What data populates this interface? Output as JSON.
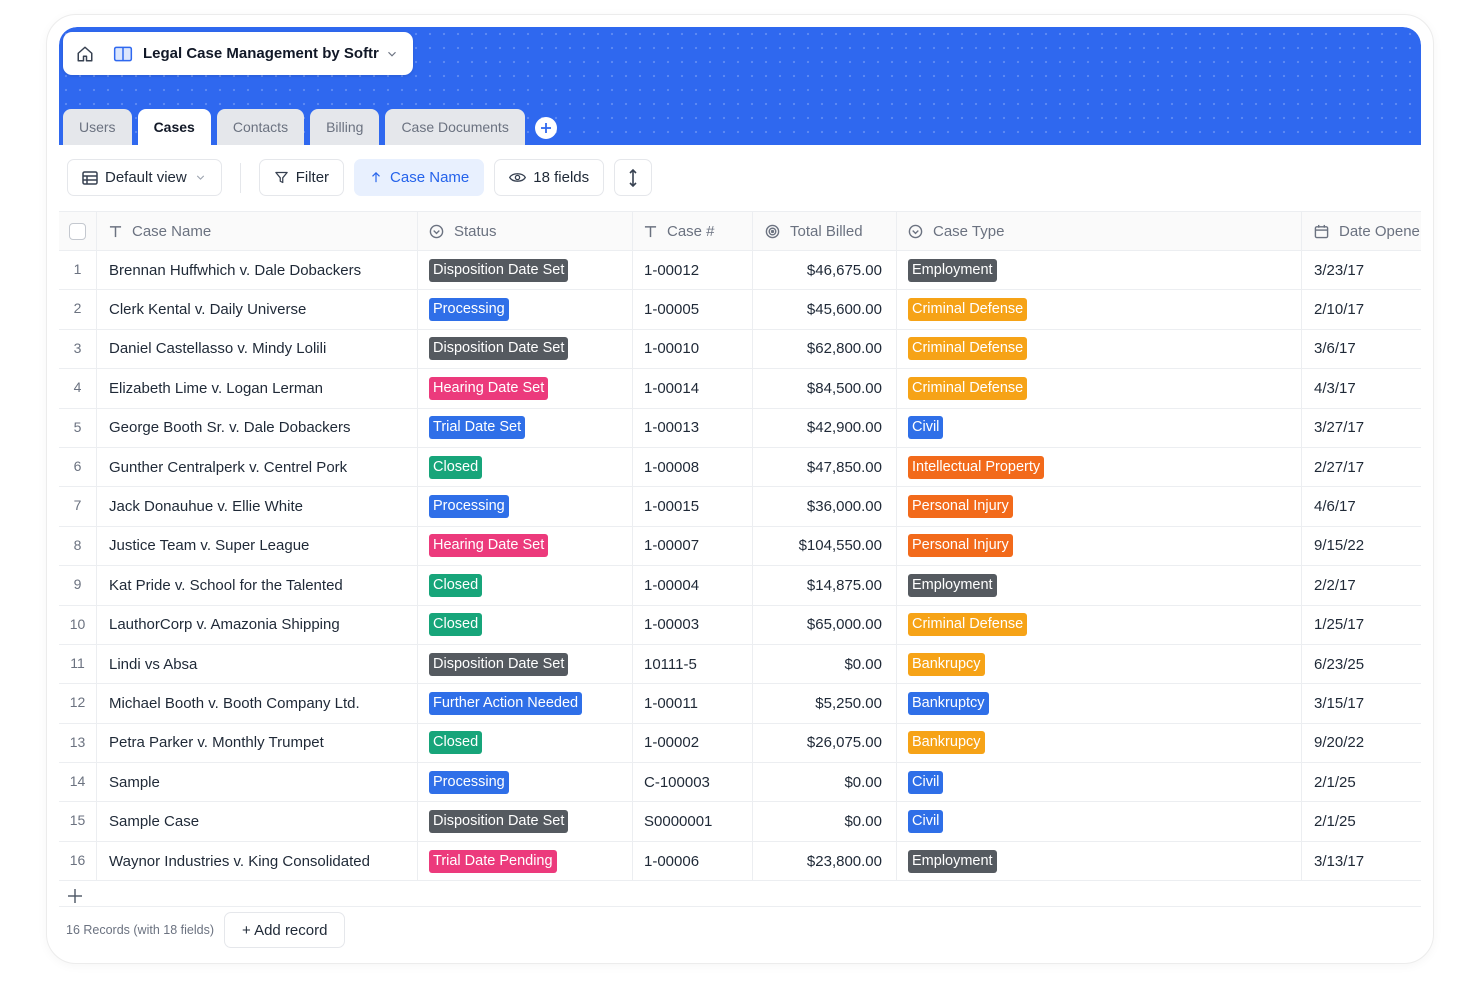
{
  "app": {
    "title": "Legal Case Management by Softr"
  },
  "tabs": [
    "Users",
    "Cases",
    "Contacts",
    "Billing",
    "Case Documents"
  ],
  "active_tab": "Cases",
  "toolbar": {
    "view_label": "Default view",
    "filter_label": "Filter",
    "sort_label": "Case Name",
    "fields_label": "18 fields"
  },
  "columns": {
    "case_name": "Case Name",
    "status": "Status",
    "case_number": "Case #",
    "total_billed": "Total Billed",
    "case_type": "Case Type",
    "date_opened": "Date Opene"
  },
  "colors": {
    "banner": "#2f68ef",
    "Disposition Date Set": "#555a60",
    "Processing": "#2f6fe8",
    "Hearing Date Set": "#ec3a7c",
    "Trial Date Set": "#2f6fe8",
    "Closed": "#17a57a",
    "Further Action Needed": "#2f6fe8",
    "Trial Date Pending": "#ec3a7c",
    "Employment": "#555a60",
    "Criminal Defense": "#f6a317",
    "Civil": "#2f6fe8",
    "Intellectual Property": "#f26a1b",
    "Personal Injury": "#f26a1b",
    "Bankrupcy": "#f6a317",
    "Bankruptcy": "#2f6fe8"
  },
  "rows": [
    {
      "num": "1",
      "name": "Brennan Huffwhich v. Dale Dobackers",
      "status": "Disposition Date Set",
      "case_no": "1-00012",
      "billed": "$46,675.00",
      "type": "Employment",
      "date": "3/23/17"
    },
    {
      "num": "2",
      "name": "Clerk Kental v. Daily Universe",
      "status": "Processing",
      "case_no": "1-00005",
      "billed": "$45,600.00",
      "type": "Criminal Defense",
      "date": "2/10/17"
    },
    {
      "num": "3",
      "name": "Daniel Castellasso v. Mindy Lolili",
      "status": "Disposition Date Set",
      "case_no": "1-00010",
      "billed": "$62,800.00",
      "type": "Criminal Defense",
      "date": "3/6/17"
    },
    {
      "num": "4",
      "name": "Elizabeth Lime v. Logan Lerman",
      "status": "Hearing Date Set",
      "case_no": "1-00014",
      "billed": "$84,500.00",
      "type": "Criminal Defense",
      "date": "4/3/17"
    },
    {
      "num": "5",
      "name": "George Booth Sr. v. Dale Dobackers",
      "status": "Trial Date Set",
      "case_no": "1-00013",
      "billed": "$42,900.00",
      "type": "Civil",
      "date": "3/27/17"
    },
    {
      "num": "6",
      "name": "Gunther Centralperk v. Centrel Pork",
      "status": "Closed",
      "case_no": "1-00008",
      "billed": "$47,850.00",
      "type": "Intellectual Property",
      "date": "2/27/17"
    },
    {
      "num": "7",
      "name": "Jack Donauhue v. Ellie White",
      "status": "Processing",
      "case_no": "1-00015",
      "billed": "$36,000.00",
      "type": "Personal Injury",
      "date": "4/6/17"
    },
    {
      "num": "8",
      "name": "Justice Team v. Super League",
      "status": "Hearing Date Set",
      "case_no": "1-00007",
      "billed": "$104,550.00",
      "type": "Personal Injury",
      "date": "9/15/22"
    },
    {
      "num": "9",
      "name": "Kat Pride v. School for the Talented",
      "status": "Closed",
      "case_no": "1-00004",
      "billed": "$14,875.00",
      "type": "Employment",
      "date": "2/2/17"
    },
    {
      "num": "10",
      "name": "LauthorCorp v. Amazonia Shipping",
      "status": "Closed",
      "case_no": "1-00003",
      "billed": "$65,000.00",
      "type": "Criminal Defense",
      "date": "1/25/17"
    },
    {
      "num": "11",
      "name": "Lindi vs Absa",
      "status": "Disposition Date Set",
      "case_no": "10111-5",
      "billed": "$0.00",
      "type": "Bankrupcy",
      "date": "6/23/25"
    },
    {
      "num": "12",
      "name": "Michael Booth v. Booth Company Ltd.",
      "status": "Further Action Needed",
      "case_no": "1-00011",
      "billed": "$5,250.00",
      "type": "Bankruptcy",
      "date": "3/15/17"
    },
    {
      "num": "13",
      "name": "Petra Parker v. Monthly Trumpet",
      "status": "Closed",
      "case_no": "1-00002",
      "billed": "$26,075.00",
      "type": "Bankrupcy",
      "date": "9/20/22"
    },
    {
      "num": "14",
      "name": "Sample",
      "status": "Processing",
      "case_no": "C-100003",
      "billed": "$0.00",
      "type": "Civil",
      "date": "2/1/25"
    },
    {
      "num": "15",
      "name": "Sample Case",
      "status": "Disposition Date Set",
      "case_no": "S0000001",
      "billed": "$0.00",
      "type": "Civil",
      "date": "2/1/25"
    },
    {
      "num": "16",
      "name": "Waynor Industries v. King Consolidated",
      "status": "Trial Date Pending",
      "case_no": "1-00006",
      "billed": "$23,800.00",
      "type": "Employment",
      "date": "3/13/17"
    }
  ],
  "footer": {
    "record_count": "16 Records (with 18 fields)",
    "add_record": "+ Add record"
  }
}
